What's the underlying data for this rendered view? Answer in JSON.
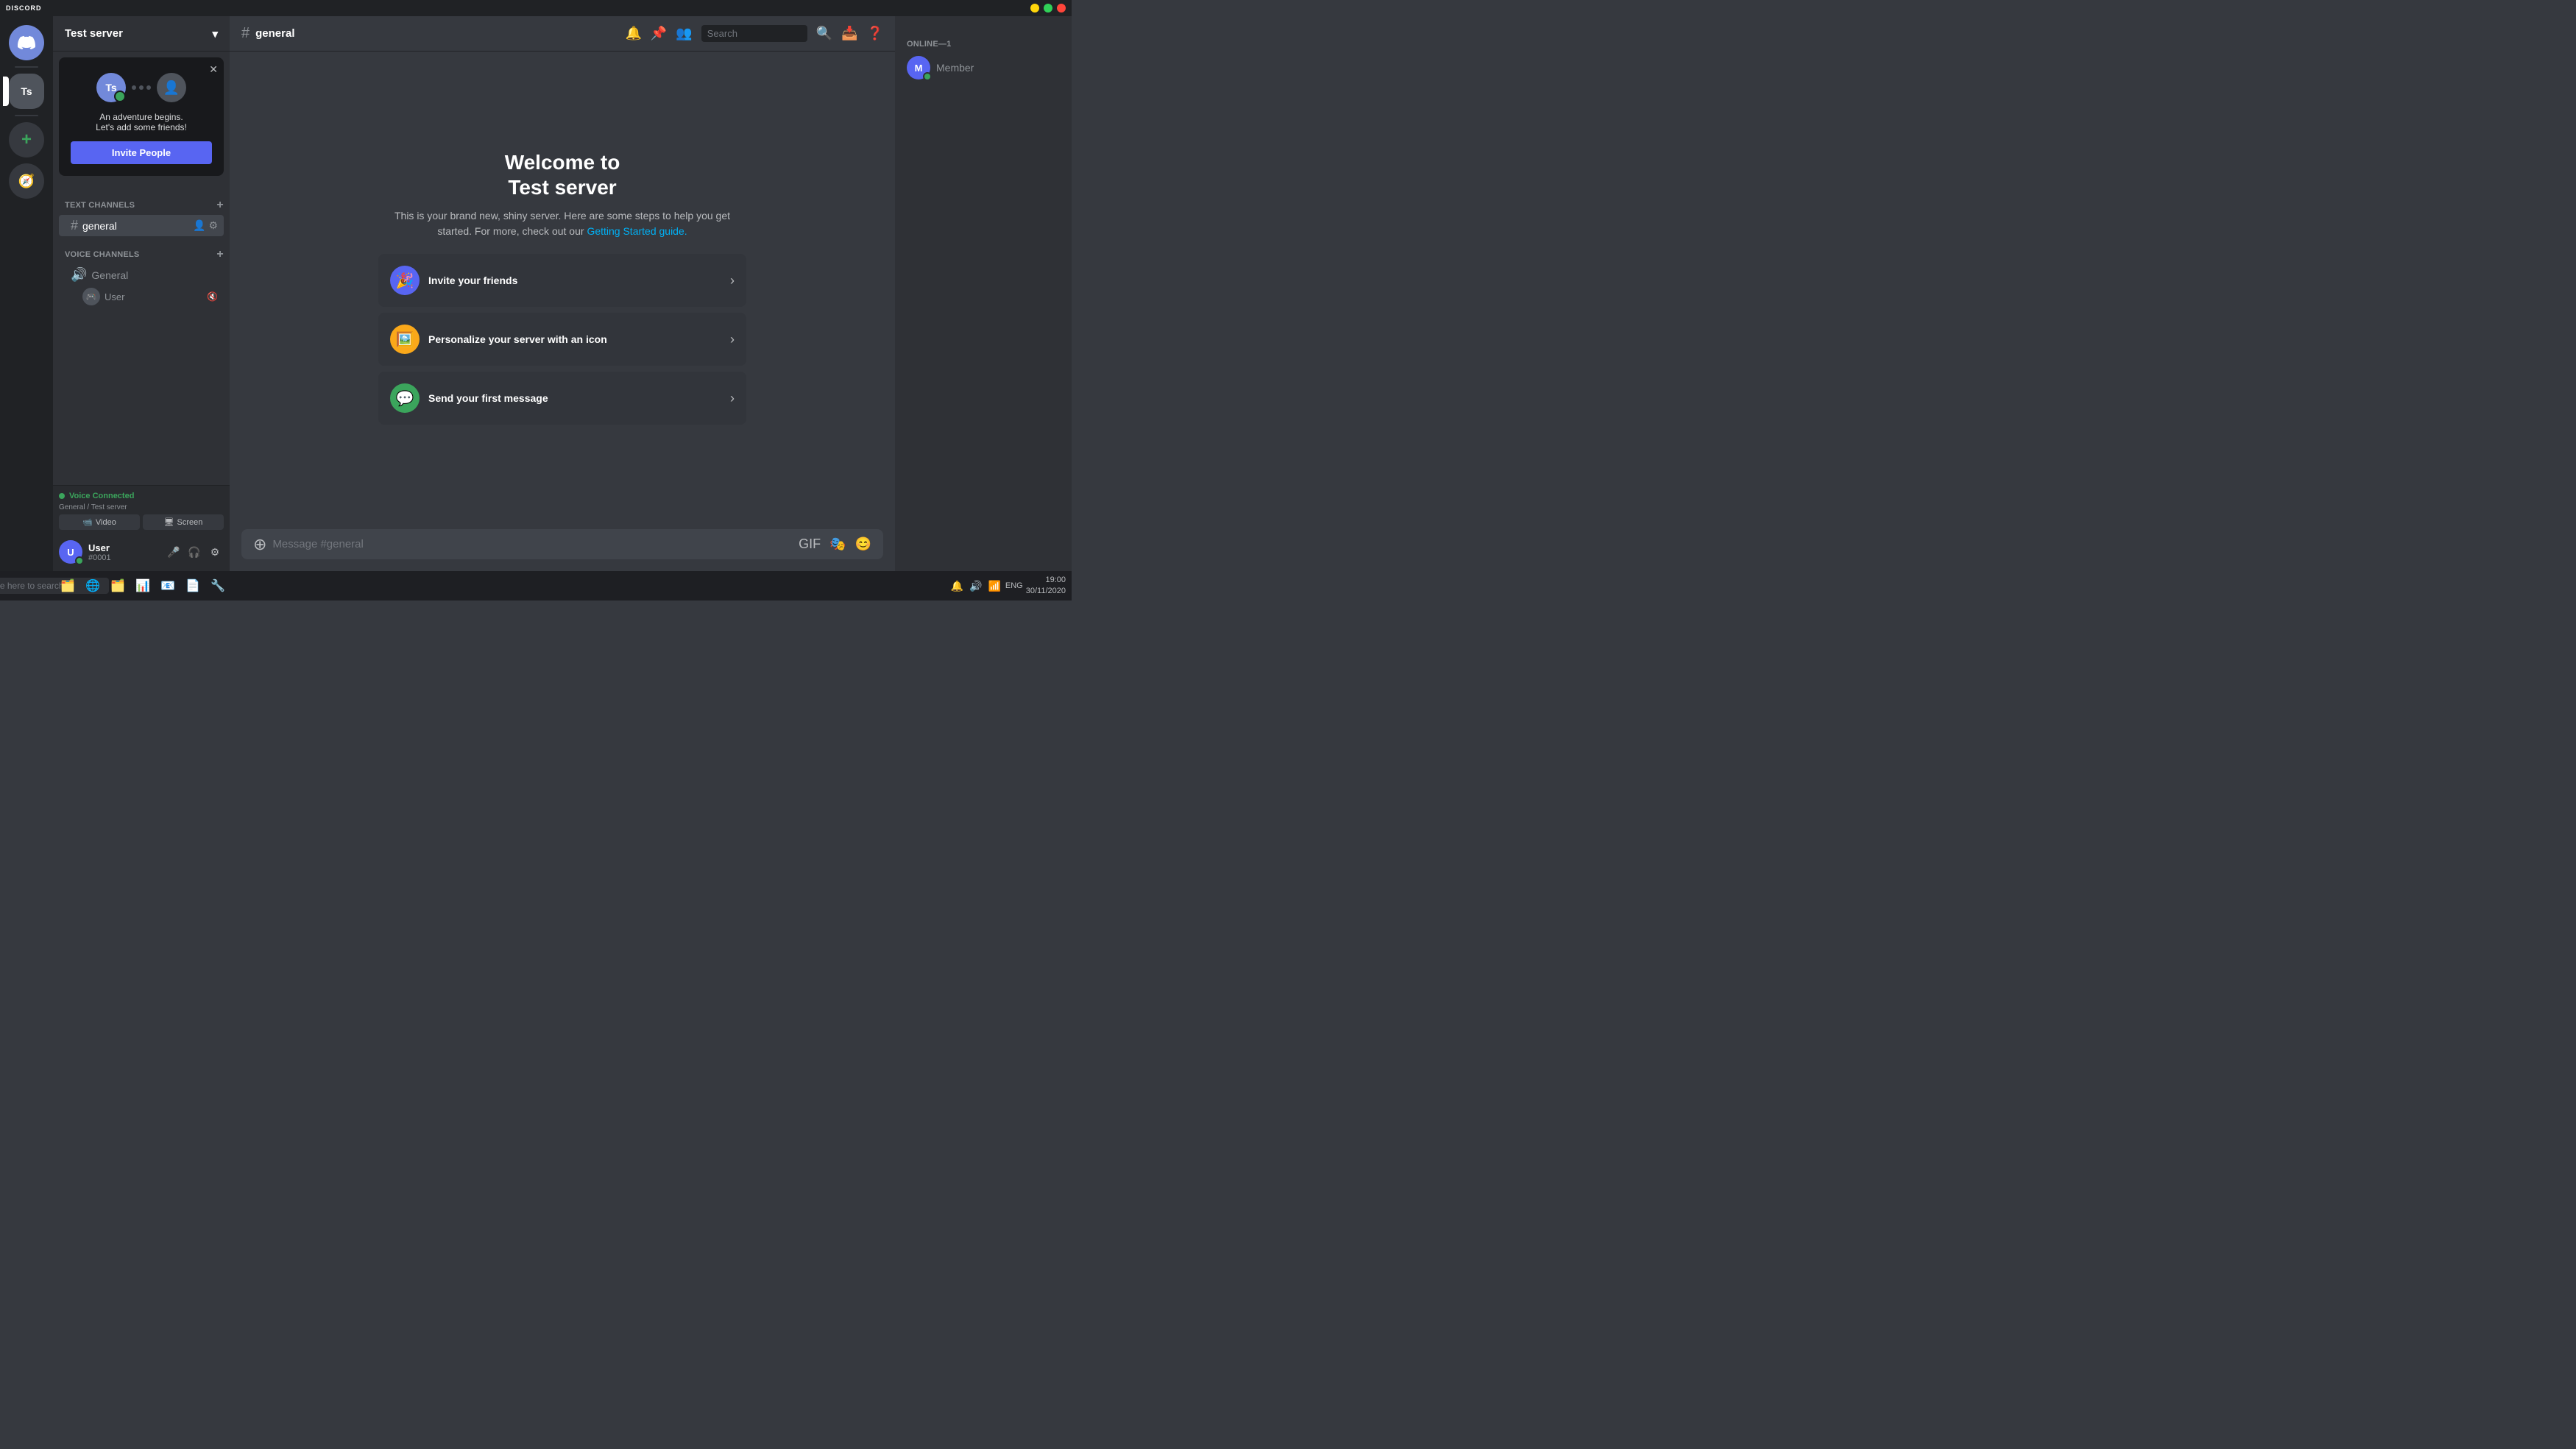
{
  "app": {
    "title": "DISCORD",
    "titlebar": {
      "minimize": "─",
      "maximize": "□",
      "close": "✕"
    }
  },
  "servers": [
    {
      "id": "discord",
      "label": "⊕",
      "type": "discord",
      "active": false
    },
    {
      "id": "ts",
      "label": "Ts",
      "type": "ts",
      "active": true,
      "notification": ""
    }
  ],
  "sidebar": {
    "server_name": "Test server",
    "invite_popup": {
      "text_line1": "An adventure begins.",
      "text_line2": "Let's add some friends!",
      "button_label": "Invite People"
    },
    "text_channels_label": "TEXT CHANNELS",
    "voice_channels_label": "VOICE CHANNELS",
    "channels": [
      {
        "id": "general",
        "name": "general",
        "type": "text",
        "active": true
      }
    ],
    "voice_channels": [
      {
        "id": "general-voice",
        "name": "General",
        "type": "voice"
      }
    ],
    "voice_users": [
      {
        "id": "user1",
        "name": "User",
        "avatar": "🎮"
      }
    ]
  },
  "voice_connected": {
    "label": "Voice Connected",
    "server": "General / Test server",
    "video_btn": "Video",
    "screen_btn": "Screen"
  },
  "user": {
    "name": "User",
    "tag": "#0001",
    "avatar_letter": "U"
  },
  "header": {
    "channel_icon": "#",
    "channel_name": "general",
    "search_placeholder": "Search"
  },
  "welcome": {
    "title_line1": "Welcome to",
    "title_line2": "Test server",
    "description": "This is your brand new, shiny server. Here are some steps to help you get started. For more, check out our",
    "link_text": "Getting Started guide.",
    "cards": [
      {
        "id": "invite",
        "title": "Invite your friends",
        "icon": "🎉",
        "icon_bg": "#5865f2"
      },
      {
        "id": "personalize",
        "title": "Personalize your server with an icon",
        "icon": "🖼️",
        "icon_bg": "#faa81a"
      },
      {
        "id": "first-message",
        "title": "Send your first message",
        "icon": "💬",
        "icon_bg": "#3ba55c"
      }
    ]
  },
  "message_input": {
    "placeholder": "Message #general"
  },
  "members": {
    "online_label": "ONLINE—1",
    "members": [
      {
        "id": "member1",
        "name": "Member",
        "avatar_letter": "M"
      }
    ]
  },
  "taskbar": {
    "search_placeholder": "Type here to search",
    "time": "19:00",
    "date": "30/11/2020",
    "apps": [
      "⊞",
      "🔍",
      "🗂️",
      "🌐",
      "🗄️",
      "📊",
      "📧",
      "📂",
      "🔧"
    ],
    "system": [
      "🔔",
      "🔊",
      "ENG"
    ]
  }
}
